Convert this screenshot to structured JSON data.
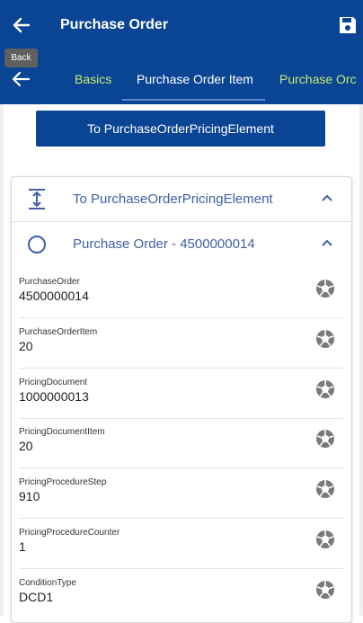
{
  "appbar": {
    "title": "Purchase Order",
    "back_icon": "arrow-left-icon",
    "save_icon": "save-icon"
  },
  "tooltip": {
    "text": "Back"
  },
  "tabs": [
    {
      "label": "Basics",
      "active": false
    },
    {
      "label": "Purchase Order Item",
      "active": true
    },
    {
      "label": "Purchase Orc",
      "active": false
    }
  ],
  "action_button": {
    "label": "To PurchaseOrderPricingElement"
  },
  "card": {
    "nav_section": {
      "label": "To PurchaseOrderPricingElement",
      "icon": "expand-vertical-icon"
    },
    "object_section": {
      "label": "Purchase Order - 4500000014",
      "icon": "circle-icon"
    },
    "fields": [
      {
        "label": "PurchaseOrder",
        "value": "4500000014"
      },
      {
        "label": "PurchaseOrderItem",
        "value": "20"
      },
      {
        "label": "PricingDocument",
        "value": "1000000013"
      },
      {
        "label": "PricingDocumentItem",
        "value": "20"
      },
      {
        "label": "PricingProcedureStep",
        "value": "910"
      },
      {
        "label": "PricingProcedureCounter",
        "value": "1"
      },
      {
        "label": "ConditionType",
        "value": "DCD1"
      }
    ]
  },
  "colors": {
    "brand": "#0a4595",
    "tab_inactive": "#c9e86b",
    "section_text": "#3f5fa6"
  }
}
